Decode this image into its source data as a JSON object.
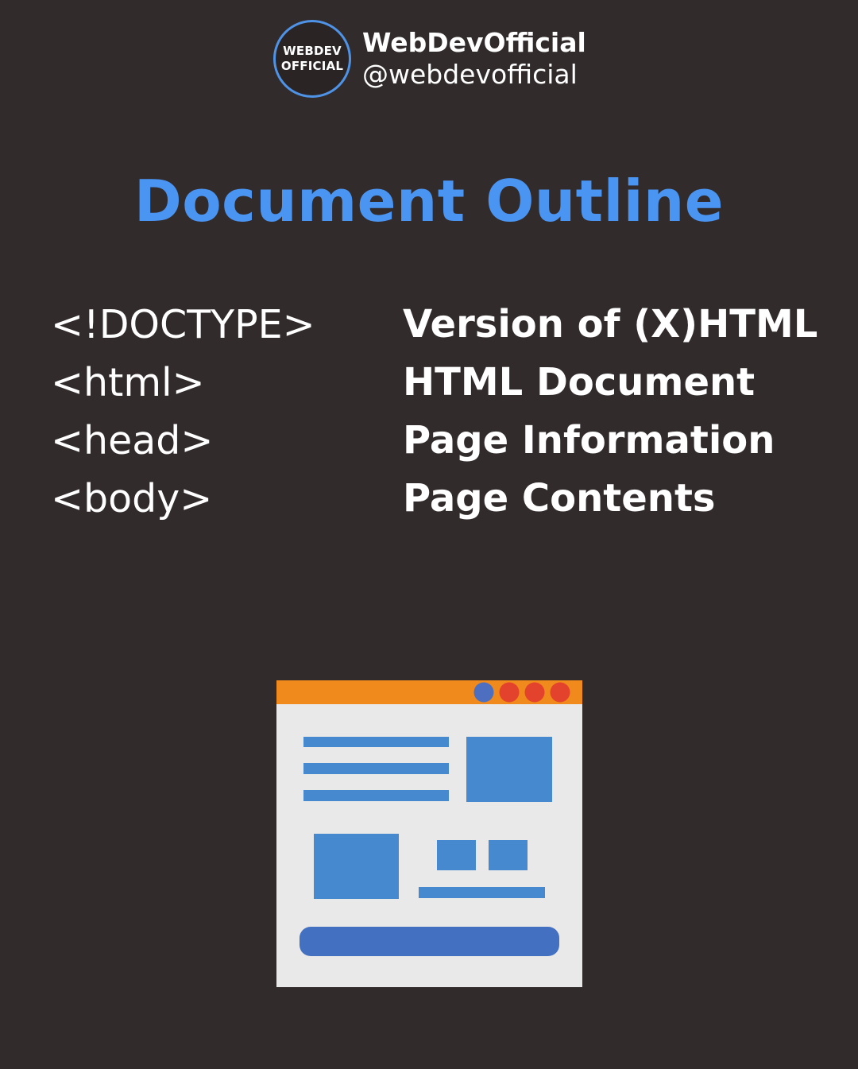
{
  "brand": {
    "logo_line1": "WEBDEV",
    "logo_line2": "OFFICIAL",
    "name": "WebDevOfficial",
    "handle": "@webdevofficial"
  },
  "title": "Document Outline",
  "outline": [
    {
      "tag": "<!DOCTYPE>",
      "description": "Version of (X)HTML"
    },
    {
      "tag": "<html>",
      "description": "HTML Document"
    },
    {
      "tag": "<head>",
      "description": "Page Information"
    },
    {
      "tag": "<body>",
      "description": "Page Contents"
    }
  ],
  "colors": {
    "background": "#322b2c",
    "title": "#4a94f2",
    "logo_ring": "#4f93e6",
    "browser_bar": "#f08a1c",
    "browser_page": "#e9e9e9",
    "block_blue": "#4689cf",
    "button_blue": "#4470c2",
    "dot_blue": "#4e6fc0",
    "dot_red": "#e3432c"
  },
  "illustration": {
    "icon": "browser-window-icon"
  }
}
